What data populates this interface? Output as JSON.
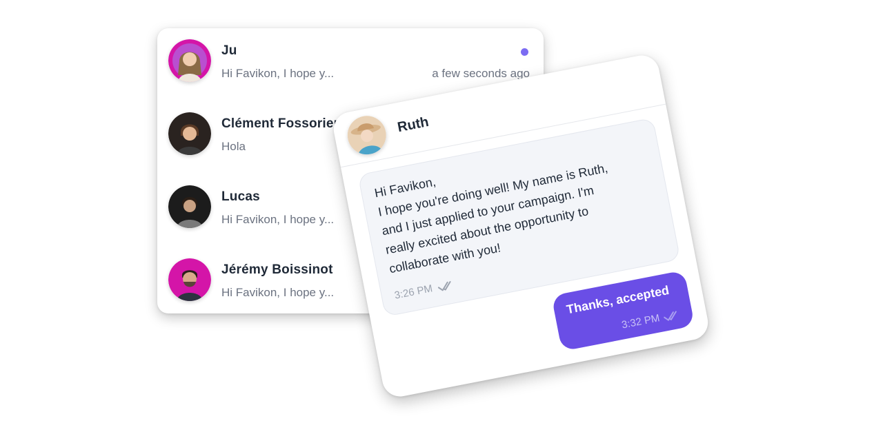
{
  "conversations": [
    {
      "name": "Ju",
      "preview": "Hi Favikon, I hope y...",
      "time": "a few seconds ago",
      "unread": true,
      "avatar_icon": "person-avatar",
      "avatar_ring": "#d415a8"
    },
    {
      "name": "Clément Fossorier",
      "preview": "Hola",
      "time": "",
      "unread": false,
      "avatar_icon": "person-avatar",
      "avatar_ring": "#2a2320"
    },
    {
      "name": "Lucas",
      "preview": "Hi Favikon, I hope y...",
      "time": "",
      "unread": false,
      "avatar_icon": "person-avatar",
      "avatar_ring": "#1c1c1c"
    },
    {
      "name": "Jérémy Boissinot",
      "preview": "Hi Favikon, I hope y...",
      "time": "",
      "unread": false,
      "avatar_icon": "person-avatar",
      "avatar_ring": "#d415a8"
    }
  ],
  "chat": {
    "contact_name": "Ruth",
    "avatar_icon": "person-avatar",
    "messages": [
      {
        "direction": "incoming",
        "text": "Hi Favikon,\nI hope you're doing well! My name is Ruth,\nand I just applied to your campaign. I'm\nreally excited about the opportunity to\ncollaborate with you!",
        "time": "3:26 PM",
        "status_icon": "double-check-icon"
      },
      {
        "direction": "outgoing",
        "text": "Thanks, accepted",
        "time": "3:32 PM",
        "status_icon": "double-check-icon"
      }
    ]
  },
  "colors": {
    "accent": "#6a4ee6",
    "unread_dot": "#7c6cf2",
    "muted_text": "#6b7280",
    "incoming_bubble": "#f3f5f9"
  }
}
